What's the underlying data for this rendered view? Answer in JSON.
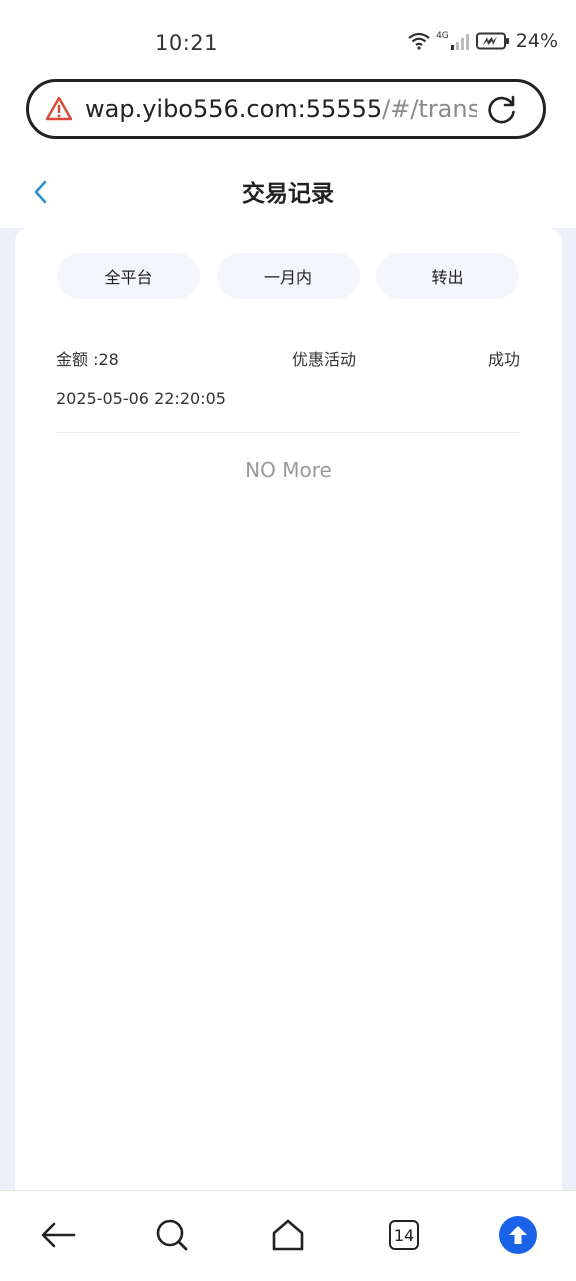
{
  "status_bar": {
    "time": "10:21",
    "network": "4G",
    "battery": "24%"
  },
  "browser": {
    "url_host": "wap.yibo556.com:55555",
    "url_path": "/#/transR"
  },
  "header": {
    "title": "交易记录"
  },
  "filters": [
    {
      "label": "全平台"
    },
    {
      "label": "一月内"
    },
    {
      "label": "转出"
    }
  ],
  "records": [
    {
      "amount": "金额 :28",
      "type": "优惠活动",
      "status": "成功",
      "time": "2025-05-06 22:20:05"
    }
  ],
  "list_end_text": "NO More",
  "bottom_nav": {
    "tabs_count": "14"
  },
  "colors": {
    "accent": "#1a63e8",
    "back_chevron": "#2a8fd4",
    "page_bg": "#edf0fa",
    "warning": "#d94a38"
  }
}
